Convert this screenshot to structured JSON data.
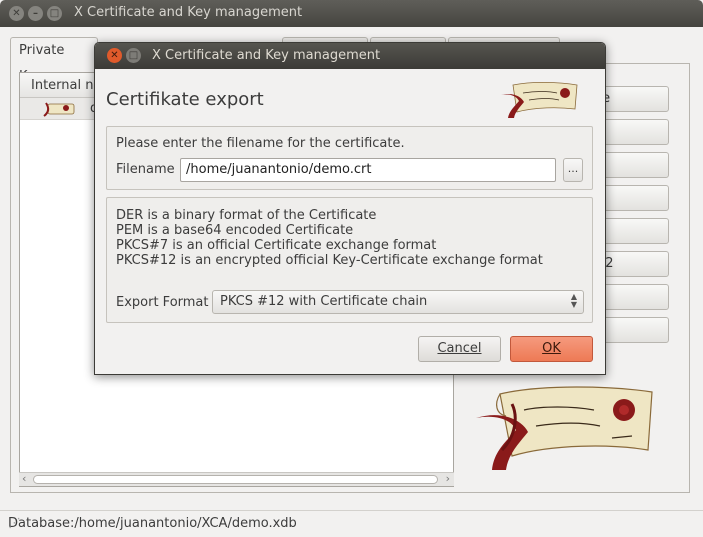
{
  "main_window": {
    "title": "X Certificate and Key management",
    "tabs": [
      {
        "label": "Private Keys",
        "active": true
      },
      {
        "label": "",
        "active": false
      },
      {
        "label": "",
        "active": false
      },
      {
        "label": "",
        "active": false
      }
    ],
    "list": {
      "header": "Internal na",
      "rows": [
        {
          "name": "d"
        }
      ]
    },
    "side_buttons": [
      "te",
      "",
      "",
      "s",
      "",
      "12",
      "7",
      ""
    ],
    "status": "Database:/home/juanantonio/XCA/demo.xdb"
  },
  "dialog": {
    "title": "X Certificate and Key management",
    "heading": "Certifikate export",
    "prompt": "Please enter the filename for the certificate.",
    "filename_label": "Filename",
    "filename_value": "/home/juanantonio/demo.crt",
    "browse_label": "...",
    "descriptions": [
      "DER is a binary format of the Certificate",
      "PEM is a base64 encoded Certificate",
      "PKCS#7 is an official Certificate exchange format",
      "PKCS#12 is an encrypted official Key-Certificate exchange format"
    ],
    "format_label": "Export Format",
    "format_value": "PKCS #12 with Certificate chain",
    "cancel_label": "Cancel",
    "ok_label": "OK"
  },
  "icons": {
    "logo": "scroll-logo-icon",
    "close": "close-icon",
    "minimize": "minimize-icon",
    "maximize": "maximize-icon"
  },
  "colors": {
    "ok_button": "#ee7a55",
    "logo_red": "#8a1a1a",
    "logo_paper": "#efe6c4"
  }
}
